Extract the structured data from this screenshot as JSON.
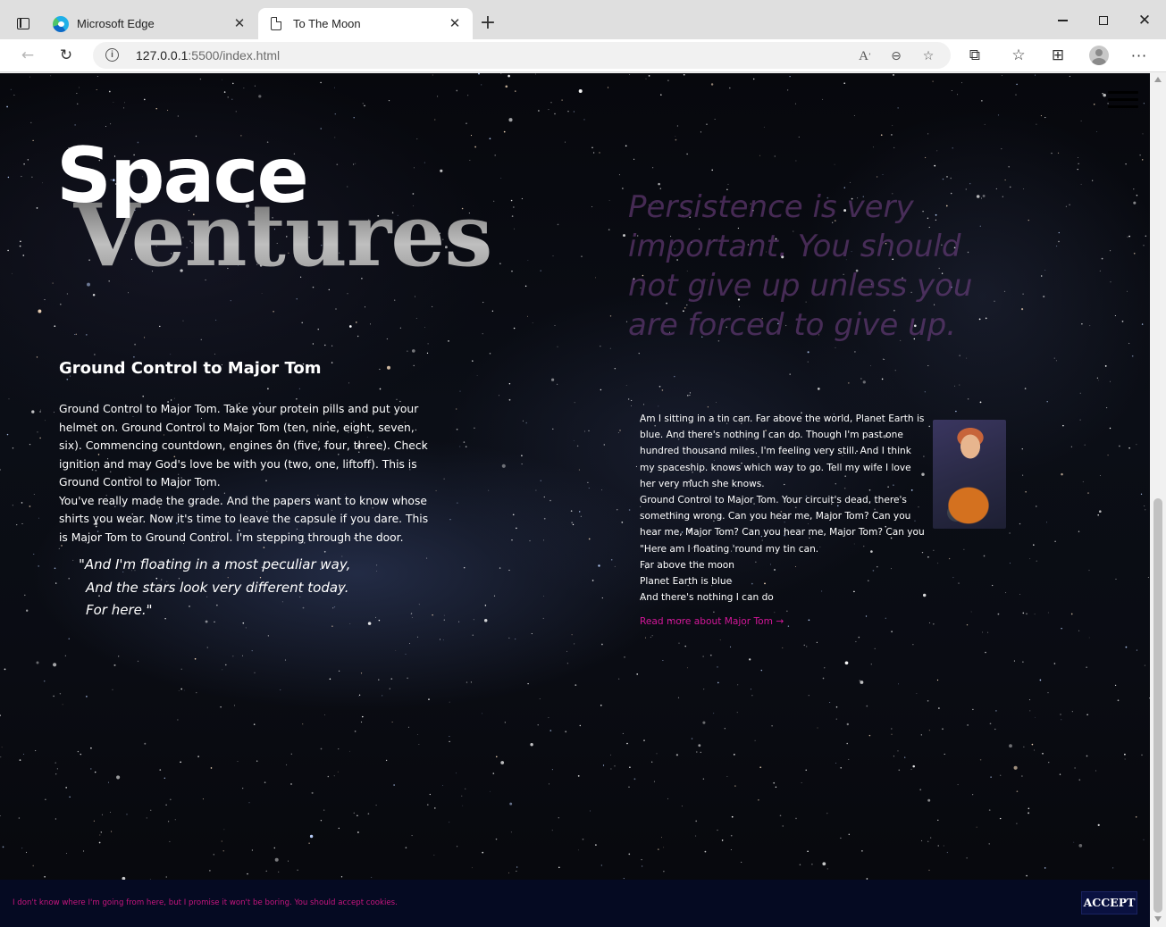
{
  "browser": {
    "tabs": [
      {
        "label": "Microsoft Edge",
        "icon": "edge-logo-icon"
      },
      {
        "label": "To The Moon",
        "icon": "document-icon"
      }
    ],
    "url_host": "127.0.0.1",
    "url_path": ":5500/index.html"
  },
  "page": {
    "brand_top": "Space",
    "brand_bottom": "Ventures",
    "quote_big": "Persistence is very important. You should not give up unless you are forced to give up.",
    "section_title": "Ground Control to Major Tom",
    "para1": "Ground Control to Major Tom. Take your protein pills and put your helmet on. Ground Control to Major Tom (ten, nine, eight, seven, six). Commencing countdown, engines on (five, four, three). Check ignition and may God's love be with you (two, one, liftoff). This is Ground Control to Major Tom.",
    "para2": "You've really made the grade. And the papers want to know whose shirts you wear. Now it's time to leave the capsule if you dare. This is Major Tom to Ground Control. I'm stepping through the door.",
    "lyric": [
      "\"And I'm floating in a most peculiar way,",
      "And the stars look very different today.",
      "For here.\""
    ],
    "right_text": "Am I sitting in a tin can. Far above the world, Planet Earth is blue. And there's nothing I can do. Though I'm past one hundred thousand miles. I'm feeling very still. And I think my spaceship. knows which way to go. Tell my wife I love her very much she knows.",
    "right_text2": "Ground Control to Major Tom. Your circuit's dead, there's something wrong. Can you hear me, Major Tom? Can you hear me, Major Tom? Can you hear me, Major Tom? Can you \"Here am I floating 'round my tin can.",
    "right_lines": [
      "Far above the moon",
      "Planet Earth is blue",
      "And there's nothing I can do"
    ],
    "read_more": "Read more about Major Tom →",
    "cookie_text": "I don't know where I'm going from here, but I promise it won't be boring. You should accept cookies.",
    "accept_label": "ACCEPT"
  },
  "colors": {
    "accent_pink": "#d4169a",
    "cookie_bg": "#050a22",
    "quote_purple": "#784690"
  }
}
